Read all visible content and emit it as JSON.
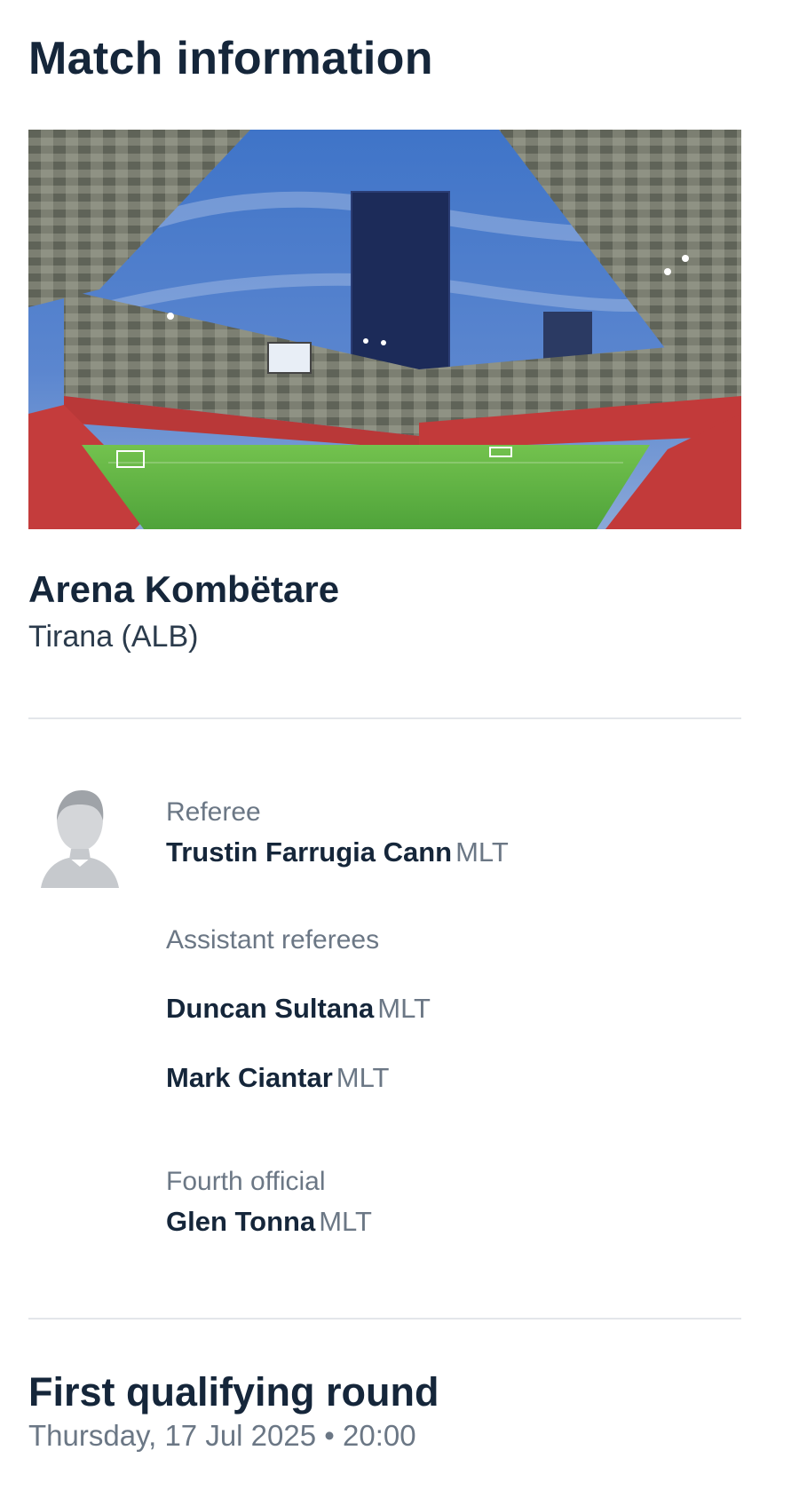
{
  "page": {
    "title": "Match information"
  },
  "venue": {
    "image_alt": "stadium-photo",
    "name": "Arena Kombëtare",
    "city": "Tirana (ALB)"
  },
  "officials": {
    "avatar_icon": "person-silhouette-icon",
    "referee": {
      "label": "Referee",
      "name": "Trustin Farrugia Cann",
      "nationality": "MLT"
    },
    "assistants": {
      "label": "Assistant referees",
      "items": [
        {
          "name": "Duncan Sultana",
          "nationality": "MLT"
        },
        {
          "name": "Mark Ciantar",
          "nationality": "MLT"
        }
      ]
    },
    "fourth_official": {
      "label": "Fourth official",
      "name": "Glen Tonna",
      "nationality": "MLT"
    }
  },
  "round": {
    "title": "First qualifying round",
    "date": "Thursday, 17 Jul 2025",
    "separator": "•",
    "time": "20:00"
  },
  "colors": {
    "text_primary": "#15263a",
    "text_secondary": "#6b7785",
    "divider": "#e3e6ea",
    "pitch": "#5fb544",
    "seats": "#c23a3a",
    "sky": "#3b6ab8"
  }
}
